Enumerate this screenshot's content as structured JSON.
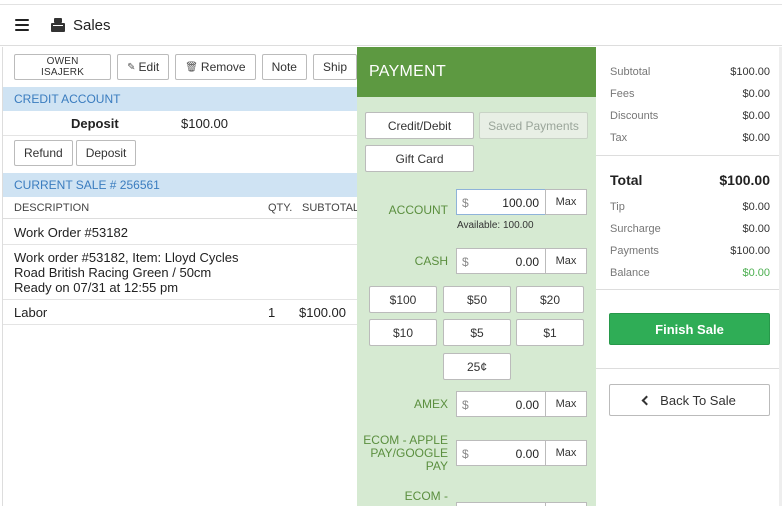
{
  "header": {
    "title": "Sales",
    "menu_icon": "hamburger-icon",
    "app_icon": "cash-register-icon"
  },
  "toolbar": {
    "customer": "OWEN ISAJERK",
    "edit": "Edit",
    "remove": "Remove",
    "note": "Note",
    "ship": "Ship"
  },
  "credit_account": {
    "title": "CREDIT ACCOUNT",
    "deposit_label": "Deposit",
    "deposit_value": "$100.00",
    "refund": "Refund",
    "deposit_button": "Deposit"
  },
  "current_sale": {
    "title": "CURRENT SALE # 256561",
    "columns": {
      "description": "DESCRIPTION",
      "qty": "QTY.",
      "subtotal": "SUBTOTAL"
    },
    "rows": [
      {
        "description": "Work Order #53182",
        "qty": "",
        "subtotal": ""
      },
      {
        "line1": "Work order #53182, Item: Lloyd Cycles",
        "line2": "Road British Racing Green / 50cm",
        "line3": "Ready on 07/31 at 12:55 pm"
      },
      {
        "description": "Labor",
        "qty": "1",
        "subtotal": "$100.00"
      }
    ]
  },
  "payment": {
    "title": "PAYMENT",
    "credit_debit": "Credit/Debit",
    "saved_payments": "Saved Payments",
    "gift_card": "Gift Card",
    "currency": "$",
    "max": "Max",
    "account": {
      "label": "ACCOUNT",
      "value": "100.00",
      "available": "Available: 100.00"
    },
    "cash": {
      "label": "CASH",
      "value": "0.00"
    },
    "quick_cash": [
      "$100",
      "$50",
      "$20",
      "$10",
      "$5",
      "$1",
      "25¢"
    ],
    "amex": {
      "label": "AMEX",
      "value": "0.00"
    },
    "ecom_apple": {
      "label_line1": "ECOM - APPLE",
      "label_line2": "PAY/GOOGLE",
      "label_line3": "PAY",
      "value": "0.00"
    },
    "ecom_next": {
      "label": "ECOM -"
    }
  },
  "summary": {
    "subtotal": {
      "label": "Subtotal",
      "value": "$100.00"
    },
    "fees": {
      "label": "Fees",
      "value": "$0.00"
    },
    "discounts": {
      "label": "Discounts",
      "value": "$0.00"
    },
    "tax": {
      "label": "Tax",
      "value": "$0.00"
    },
    "total": {
      "label": "Total",
      "value": "$100.00"
    },
    "tip": {
      "label": "Tip",
      "value": "$0.00"
    },
    "surcharge": {
      "label": "Surcharge",
      "value": "$0.00"
    },
    "payments": {
      "label": "Payments",
      "value": "$100.00"
    },
    "balance": {
      "label": "Balance",
      "value": "$0.00"
    },
    "finish_sale": "Finish Sale",
    "back_to_sale": "Back To Sale"
  },
  "colors": {
    "payment_header": "#5d9941",
    "payment_bg": "#d6ead2",
    "section_head": "#cfe3f3",
    "finish_green": "#2fad56",
    "balance_green": "#4caf50"
  }
}
